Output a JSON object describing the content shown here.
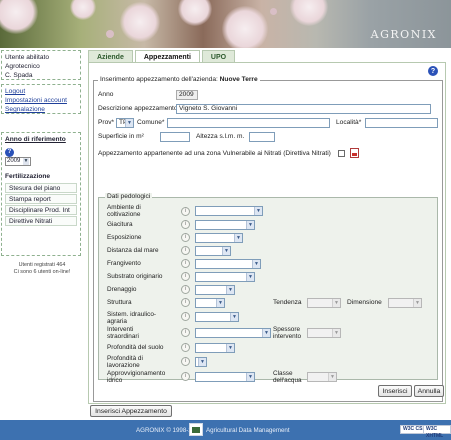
{
  "app": {
    "brand": "AGRONIX"
  },
  "sidebar": {
    "user_status": "Utente abilitato",
    "role": "Agrotecnico",
    "user_name": "C. Spada",
    "links": [
      "Logout",
      "Impostazioni account",
      "Segnalazione"
    ],
    "year_title": "Anno di riferimento",
    "year_value": "2009",
    "section_title": "Fertilizzazione",
    "menu": [
      "Stesura del piano",
      "Stampa report",
      "Disciplinare Prod. Int",
      "Direttive Nitrati"
    ],
    "users_registered": "Utenti registrati 464",
    "users_online": "Ci sono 6 utenti on-line!"
  },
  "tabs": [
    "Aziende",
    "Appezzamenti",
    "UPO"
  ],
  "form": {
    "legend": "Inserimento appezzamento dell'azienda:",
    "farm_name": "Nuove Terre",
    "anno_label": "Anno",
    "anno_value": "2009",
    "descr_label": "Descrizione appezzamento : *",
    "descr_value": "Vigneto S. Giovanni",
    "prov_label": "Prov*",
    "prov_value": "TP",
    "comune_label": "Comune*",
    "comune_value": "",
    "localita_label": "Località*",
    "localita_value": "",
    "superficie_label": "Superficie in m²",
    "superficie_value": "",
    "altezza_label": "Altezza s.l.m. m.",
    "altezza_value": "",
    "zone_label": "Appezzamento appartenente ad una zona Vulnerabile ai Nitrati (Direttiva Nitrati)"
  },
  "pedo": {
    "legend": "Dati pedologici",
    "rows": [
      "Ambiente di coltivazione",
      "Giacitura",
      "Esposizione",
      "Distanza dal mare",
      "Frangivento",
      "Substrato originario",
      "Drenaggio",
      "Struttura",
      "Sistem. idraulico-agraria",
      "Interventi straordinari",
      "Profondità del suolo",
      "Profondità di lavorazione",
      "Approvvigionamento idrico"
    ],
    "tendenza_label": "Tendenza",
    "dimensione_label": "Dimensione",
    "spessore_label": "Spessore intervento",
    "classe_label": "Classe dell'acqua"
  },
  "buttons": {
    "inserisci": "Inserisci",
    "annulla": "Annulla",
    "inserisci_app": "Inserisci Appezzamento"
  },
  "footer": {
    "copyright": "AGRONIX  © 1998-2009",
    "company": "Agricultural Data Management",
    "badge1": "W3C CSS",
    "badge2": "W3C XHTML"
  }
}
